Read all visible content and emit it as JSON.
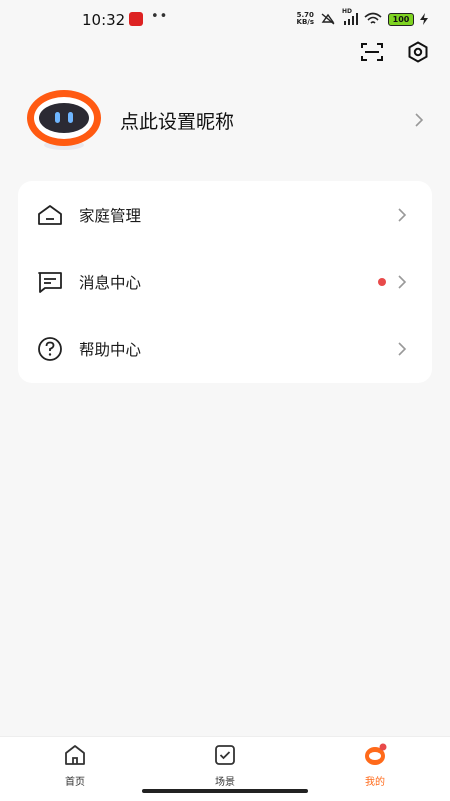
{
  "status_bar": {
    "time": "10:32",
    "dots": "••",
    "net_speed_value": "5.70",
    "net_speed_unit": "KB/s",
    "signal_label": "HD",
    "battery": "100"
  },
  "profile": {
    "nickname": "点此设置昵称"
  },
  "menu": {
    "items": [
      {
        "label": "家庭管理",
        "icon": "home-outline-icon"
      },
      {
        "label": "消息中心",
        "icon": "message-icon",
        "has_unread": true
      },
      {
        "label": "帮助中心",
        "icon": "help-circle-icon"
      }
    ]
  },
  "tab_bar": {
    "tabs": [
      {
        "label": "首页",
        "icon": "home-icon",
        "active": false
      },
      {
        "label": "场景",
        "icon": "scene-check-icon",
        "active": false
      },
      {
        "label": "我的",
        "icon": "profile-icon",
        "active": true
      }
    ]
  },
  "colors": {
    "accent": "#ff6a1a",
    "unread_dot": "#e84a4a",
    "background": "#f7f7f7",
    "card": "#ffffff"
  }
}
